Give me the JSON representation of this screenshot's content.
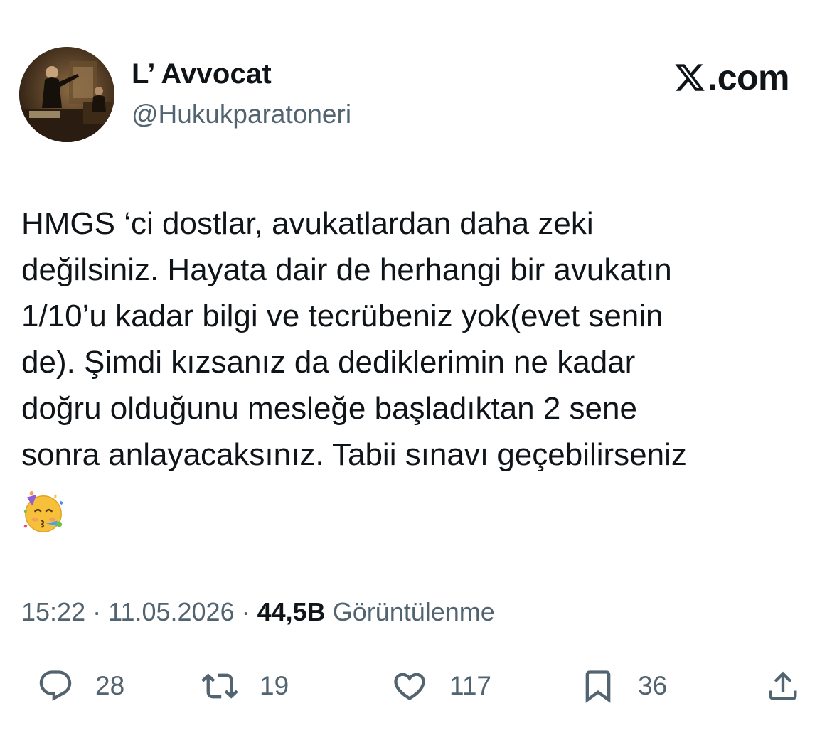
{
  "author": {
    "display_name": "L’ Avvocat",
    "handle": "@Hukukparatoneri",
    "avatar": "courtroom-painting-avatar"
  },
  "brand": {
    "icon": "x-logo-icon",
    "text": ".com"
  },
  "tweet": {
    "text": "HMGS ‘ci dostlar, avukatlardan daha zeki\ndeğilsiniz. Hayata dair de herhangi bir avukatın\n1/10’u kadar bilgi ve tecrübeniz yok(evet senin\nde). Şimdi kızsanız da dediklerimin ne kadar\ndoğru olduğunu mesleğe başladıktan 2 sene\nsonra anlayacaksınız. Tabii sınavı geçebilirseniz",
    "emoji": "partying-face-emoji"
  },
  "meta": {
    "time": "15:22",
    "date": "11.05.2026",
    "separator": "·",
    "views_count": "44,5B",
    "views_label": "Görüntülenme"
  },
  "actions": {
    "reply": {
      "icon": "reply-icon",
      "count": "28"
    },
    "retweet": {
      "icon": "retweet-icon",
      "count": "19"
    },
    "like": {
      "icon": "heart-icon",
      "count": "117"
    },
    "bookmark": {
      "icon": "bookmark-icon",
      "count": "36"
    },
    "share": {
      "icon": "share-icon"
    }
  },
  "colors": {
    "text_primary": "#0f1419",
    "text_secondary": "#536471",
    "background": "#ffffff"
  }
}
